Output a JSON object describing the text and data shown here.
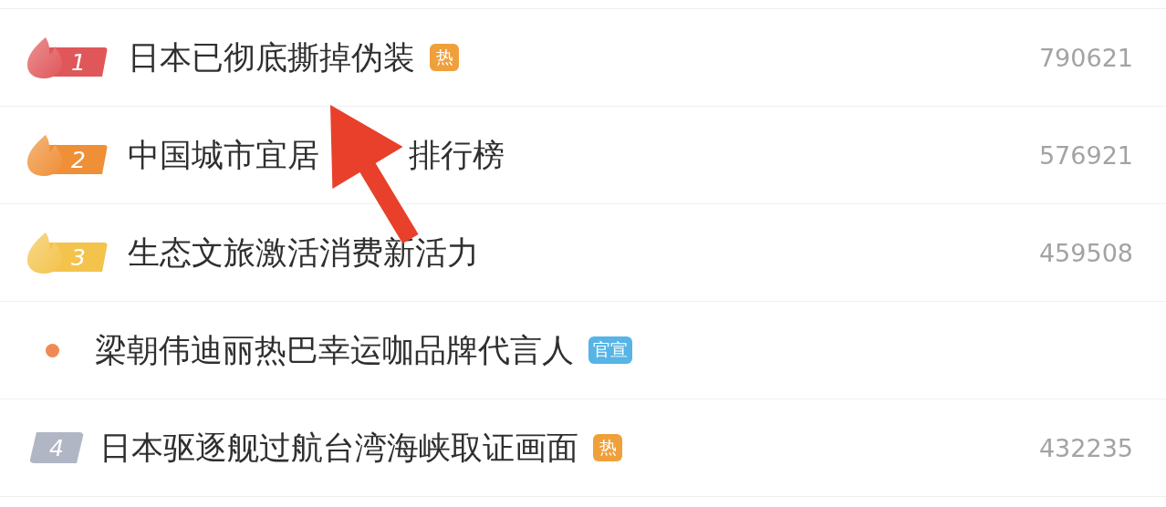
{
  "hot_list": [
    {
      "kind": "top",
      "rank": "1",
      "color": "#e0575a",
      "title_parts": [
        "日本已彻底撕掉伪装"
      ],
      "tag": {
        "label": "热",
        "color": "#f0a03a"
      },
      "count": "790621"
    },
    {
      "kind": "top",
      "rank": "2",
      "color": "#ef8f36",
      "title_parts": [
        "中国城市宜居",
        "排行榜"
      ],
      "count": "576921"
    },
    {
      "kind": "top",
      "rank": "3",
      "color": "#f3c34c",
      "title_parts": [
        "生态文旅激活消费新活力"
      ],
      "count": "459508"
    },
    {
      "kind": "promo",
      "color": "#f08a55",
      "title_parts": [
        "梁朝伟迪丽热巴幸运咖品牌代言人"
      ],
      "tag": {
        "label": "官宣",
        "color": "#56b4e6"
      }
    },
    {
      "kind": "plain",
      "rank": "4",
      "color": "#b0b6c4",
      "title_parts": [
        "日本驱逐舰过航台湾海峡取证画面"
      ],
      "tag": {
        "label": "热",
        "color": "#f0a03a"
      },
      "count": "432235"
    }
  ]
}
